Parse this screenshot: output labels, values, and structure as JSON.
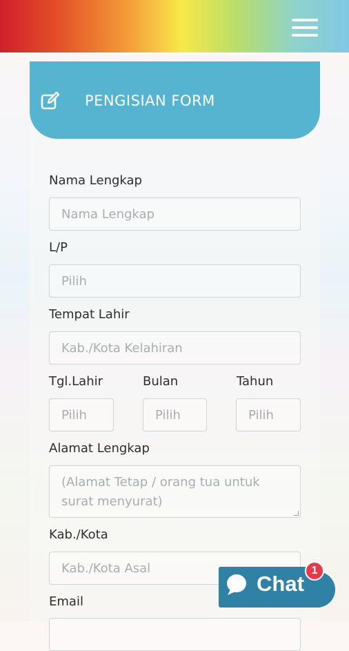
{
  "header": {
    "menu_icon": "hamburger-menu-icon"
  },
  "form": {
    "title": "PENGISIAN FORM",
    "title_icon": "edit-icon",
    "nama": {
      "label": "Nama Lengkap",
      "placeholder": "Nama Lengkap"
    },
    "lp": {
      "label": "L/P",
      "value": "Pilih"
    },
    "tempat": {
      "label": "Tempat Lahir",
      "placeholder": "Kab./Kota Kelahiran"
    },
    "tgl": {
      "label": "Tgl.Lahir",
      "value": "Pilih"
    },
    "bulan": {
      "label": "Bulan",
      "value": "Pilih"
    },
    "tahun": {
      "label": "Tahun",
      "value": "Pilih"
    },
    "alamat": {
      "label": "Alamat Lengkap",
      "placeholder": "(Alamat Tetap / orang tua untuk surat menyurat)"
    },
    "kota": {
      "label": "Kab./Kota",
      "placeholder": "Kab./Kota Asal"
    },
    "email": {
      "label": "Email"
    }
  },
  "chat": {
    "label": "Chat",
    "badge": "1",
    "icon": "chat-bubble-icon"
  },
  "colors": {
    "header_accent": "#55b4cf",
    "chat_bg": "#2f82a6",
    "badge": "#e8384a"
  }
}
